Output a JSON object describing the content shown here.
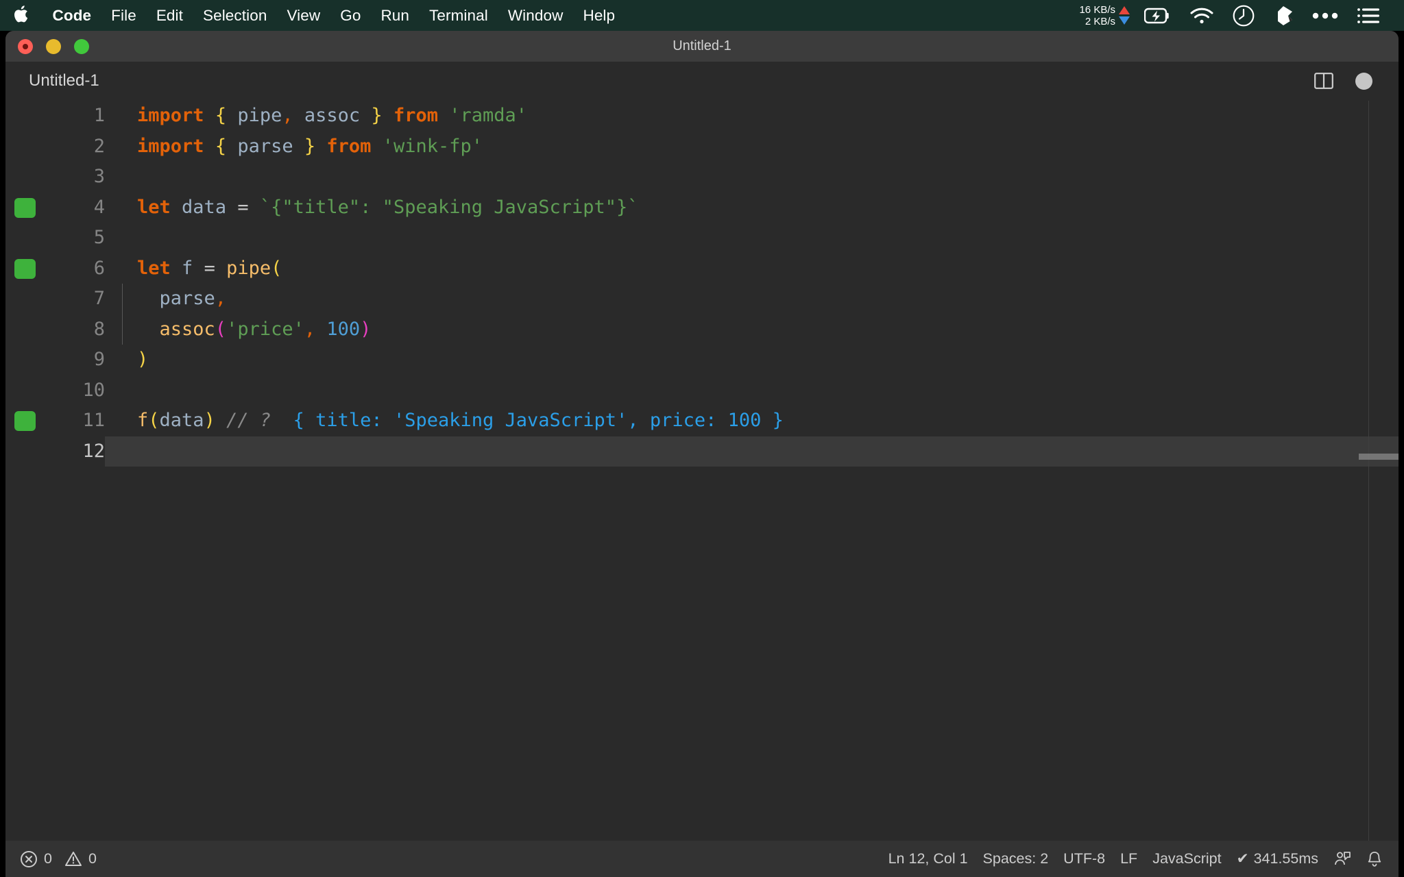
{
  "menubar": {
    "apple_icon": "apple-logo-icon",
    "items": [
      {
        "label": "Code",
        "bold": true
      },
      {
        "label": "File",
        "bold": false
      },
      {
        "label": "Edit",
        "bold": false
      },
      {
        "label": "Selection",
        "bold": false
      },
      {
        "label": "View",
        "bold": false
      },
      {
        "label": "Go",
        "bold": false
      },
      {
        "label": "Run",
        "bold": false
      },
      {
        "label": "Terminal",
        "bold": false
      },
      {
        "label": "Window",
        "bold": false
      },
      {
        "label": "Help",
        "bold": false
      }
    ],
    "network": {
      "upload": "16 KB/s",
      "download": "2 KB/s",
      "upload_color": "#e8463c",
      "download_color": "#3b8ee0"
    },
    "tray_icons": [
      "battery-charging-icon",
      "wifi-icon",
      "clock-icon",
      "dropbox-icon",
      "control-center-icon",
      "list-menu-icon"
    ]
  },
  "window": {
    "title": "Untitled-1",
    "traffic_lights": [
      "close-button",
      "minimize-button",
      "maximize-button"
    ]
  },
  "tabbar": {
    "tabs": [
      {
        "label": "Untitled-1",
        "active": true
      }
    ],
    "actions": [
      "split-editor-icon",
      "unsaved-dot-icon"
    ]
  },
  "editor": {
    "language": "JavaScript",
    "current_line": 12,
    "lines": [
      {
        "n": "1",
        "marker": false,
        "indent": false
      },
      {
        "n": "2",
        "marker": false,
        "indent": false
      },
      {
        "n": "3",
        "marker": false,
        "indent": false
      },
      {
        "n": "4",
        "marker": true,
        "indent": false
      },
      {
        "n": "5",
        "marker": false,
        "indent": false
      },
      {
        "n": "6",
        "marker": true,
        "indent": false
      },
      {
        "n": "7",
        "marker": false,
        "indent": true
      },
      {
        "n": "8",
        "marker": false,
        "indent": true
      },
      {
        "n": "9",
        "marker": false,
        "indent": false
      },
      {
        "n": "10",
        "marker": false,
        "indent": false
      },
      {
        "n": "11",
        "marker": true,
        "indent": false
      },
      {
        "n": "12",
        "marker": false,
        "indent": false
      }
    ],
    "code": {
      "l1": {
        "kw1": "import",
        "b1": "{",
        "v1": " pipe",
        "c1": ",",
        "v2": " assoc ",
        "b2": "}",
        "kw2": " from ",
        "s1": "'ramda'"
      },
      "l2": {
        "kw1": "import",
        "b1": "{",
        "v1": " parse ",
        "b2": "}",
        "kw2": " from ",
        "s1": "'wink-fp'"
      },
      "l4": {
        "kw1": "let",
        "v1": "data",
        "op": "=",
        "s1": "`{\"title\": \"Speaking JavaScript\"}`"
      },
      "l6": {
        "kw1": "let",
        "v1": "f",
        "op": "=",
        "fn": "pipe",
        "b1": "("
      },
      "l7": {
        "v1": "parse",
        "c1": ","
      },
      "l8": {
        "fn": "assoc",
        "b1": "(",
        "s1": "'price'",
        "c1": ",",
        "num": "100",
        "b2": ")"
      },
      "l9": {
        "b1": ")"
      },
      "l11": {
        "fn": "f",
        "b1": "(",
        "v1": "data",
        "b2": ")",
        "comment": "// ?",
        "result": "{ title: 'Speaking JavaScript', price: 100 }"
      }
    },
    "colors": {
      "keyword": "#e36209",
      "variable": "#9eb1c4",
      "bracket_level1": "#f5d347",
      "bracket_level2": "#e83fc0",
      "string": "#5f9e55",
      "function": "#f6bd6a",
      "number": "#4f9fd6",
      "comment": "#8a8a8a",
      "inline_result": "#2b9fe8",
      "gutter_marker": "#3eb23c",
      "background": "#2a2a2a"
    }
  },
  "statusbar": {
    "errors": "0",
    "warnings": "0",
    "position": "Ln 12, Col 1",
    "indentation": "Spaces: 2",
    "encoding": "UTF-8",
    "eol": "LF",
    "language": "JavaScript",
    "run_time": "341.55ms",
    "run_check": "✔",
    "right_icons": [
      "feedback-person-icon",
      "notifications-bell-icon"
    ]
  }
}
